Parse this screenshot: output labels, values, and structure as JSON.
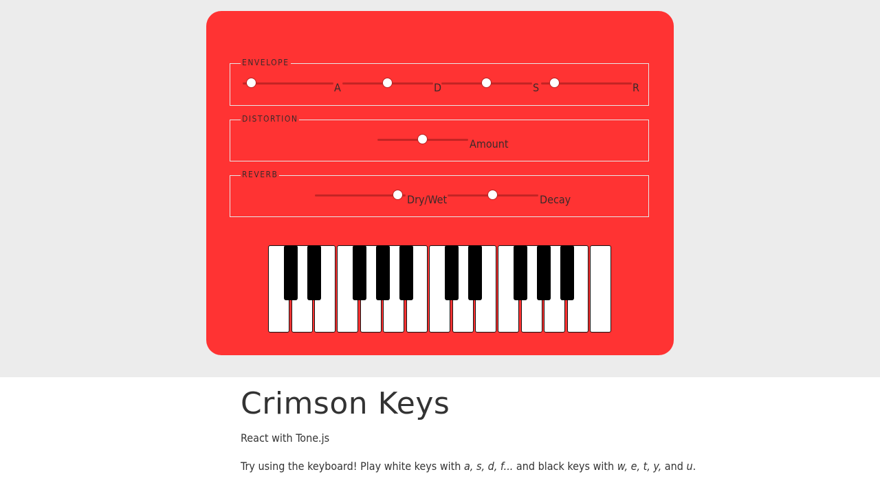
{
  "envelope": {
    "legend": "ENVELOPE",
    "sliders": [
      {
        "label": "A",
        "value": 0.1
      },
      {
        "label": "D",
        "value": 0.5
      },
      {
        "label": "S",
        "value": 0.5
      },
      {
        "label": "R",
        "value": 0.15
      }
    ]
  },
  "distortion": {
    "legend": "DISTORTION",
    "sliders": [
      {
        "label": "Amount",
        "value": 0.5
      }
    ]
  },
  "reverb": {
    "legend": "REVERB",
    "sliders": [
      {
        "label": "Dry/Wet",
        "value": 0.92
      },
      {
        "label": "Decay",
        "value": 0.5
      }
    ]
  },
  "keyboard": {
    "white_keys": 15,
    "black_keys": 10
  },
  "page": {
    "title": "Crimson Keys",
    "subtitle": "React with Tone.js",
    "tip_prefix": "Try using the keyboard! Play white keys with ",
    "tip_white_keys": "a, s, d, f...",
    "tip_middle": " and black keys with ",
    "tip_black_keys": "w, e, t, y,",
    "tip_and": " and ",
    "tip_last_key": "u",
    "tip_end": "."
  },
  "colors": {
    "synth_body": "#ff3333",
    "background": "#ececec",
    "track": "#c42424"
  }
}
